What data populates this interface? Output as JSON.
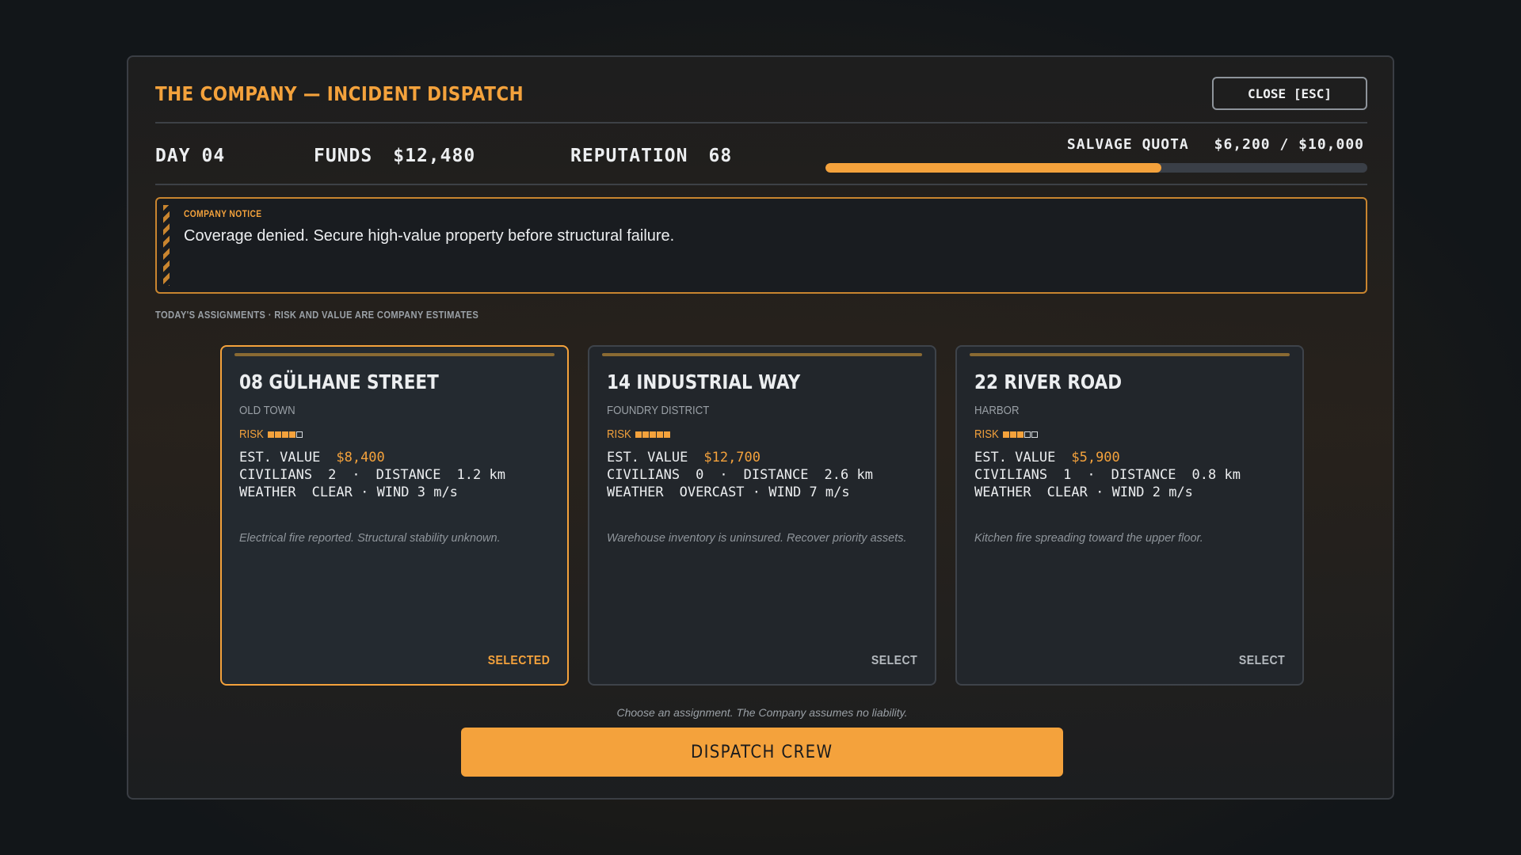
{
  "header": {
    "title": "THE COMPANY — INCIDENT DISPATCH",
    "close_label": "CLOSE [ESC]"
  },
  "stats": {
    "day_label": "DAY",
    "day_value": "04",
    "funds_label": "FUNDS",
    "funds_value": "$12,480",
    "reputation_label": "REPUTATION",
    "reputation_value": "68",
    "quota_label": "SALVAGE QUOTA",
    "quota_value": "$6,200 / $10,000",
    "quota_fraction": 0.62
  },
  "notice": {
    "label": "COMPANY NOTICE",
    "message": "Coverage denied. Secure high-value property before structural failure."
  },
  "assignments_label": "TODAY'S ASSIGNMENTS · RISK AND VALUE ARE COMPANY ESTIMATES",
  "cards": [
    {
      "name": "08 GÜLHANE STREET",
      "district": "OLD TOWN",
      "risk_label": "RISK",
      "risk_level": 4,
      "risk_max": 5,
      "value_label": "EST. VALUE",
      "value": "$8,400",
      "civilians_label": "CIVILIANS",
      "civilians": "2",
      "distance_label": "DISTANCE",
      "distance": "1.2 km",
      "weather_label": "WEATHER",
      "weather": "CLEAR",
      "wind": "WIND 3 m/s",
      "description": "Electrical fire reported. Structural stability unknown.",
      "action": "SELECTED",
      "selected": true
    },
    {
      "name": "14 INDUSTRIAL WAY",
      "district": "FOUNDRY DISTRICT",
      "risk_label": "RISK",
      "risk_level": 5,
      "risk_max": 5,
      "value_label": "EST. VALUE",
      "value": "$12,700",
      "civilians_label": "CIVILIANS",
      "civilians": "0",
      "distance_label": "DISTANCE",
      "distance": "2.6 km",
      "weather_label": "WEATHER",
      "weather": "OVERCAST",
      "wind": "WIND 7 m/s",
      "description": "Warehouse inventory is uninsured. Recover priority assets.",
      "action": "SELECT",
      "selected": false
    },
    {
      "name": "22 RIVER ROAD",
      "district": "HARBOR",
      "risk_label": "RISK",
      "risk_level": 3,
      "risk_max": 5,
      "value_label": "EST. VALUE",
      "value": "$5,900",
      "civilians_label": "CIVILIANS",
      "civilians": "1",
      "distance_label": "DISTANCE",
      "distance": "0.8 km",
      "weather_label": "WEATHER",
      "weather": "CLEAR",
      "wind": "WIND 2 m/s",
      "description": "Kitchen fire spreading toward the upper floor.",
      "action": "SELECT",
      "selected": false
    }
  ],
  "footer": {
    "hint": "Choose an assignment. The Company assumes no liability.",
    "dispatch_label": "DISPATCH CREW"
  },
  "colors": {
    "accent": "#f4a23c",
    "panel_border": "#3a3e44",
    "card_bg": "#22262b"
  }
}
